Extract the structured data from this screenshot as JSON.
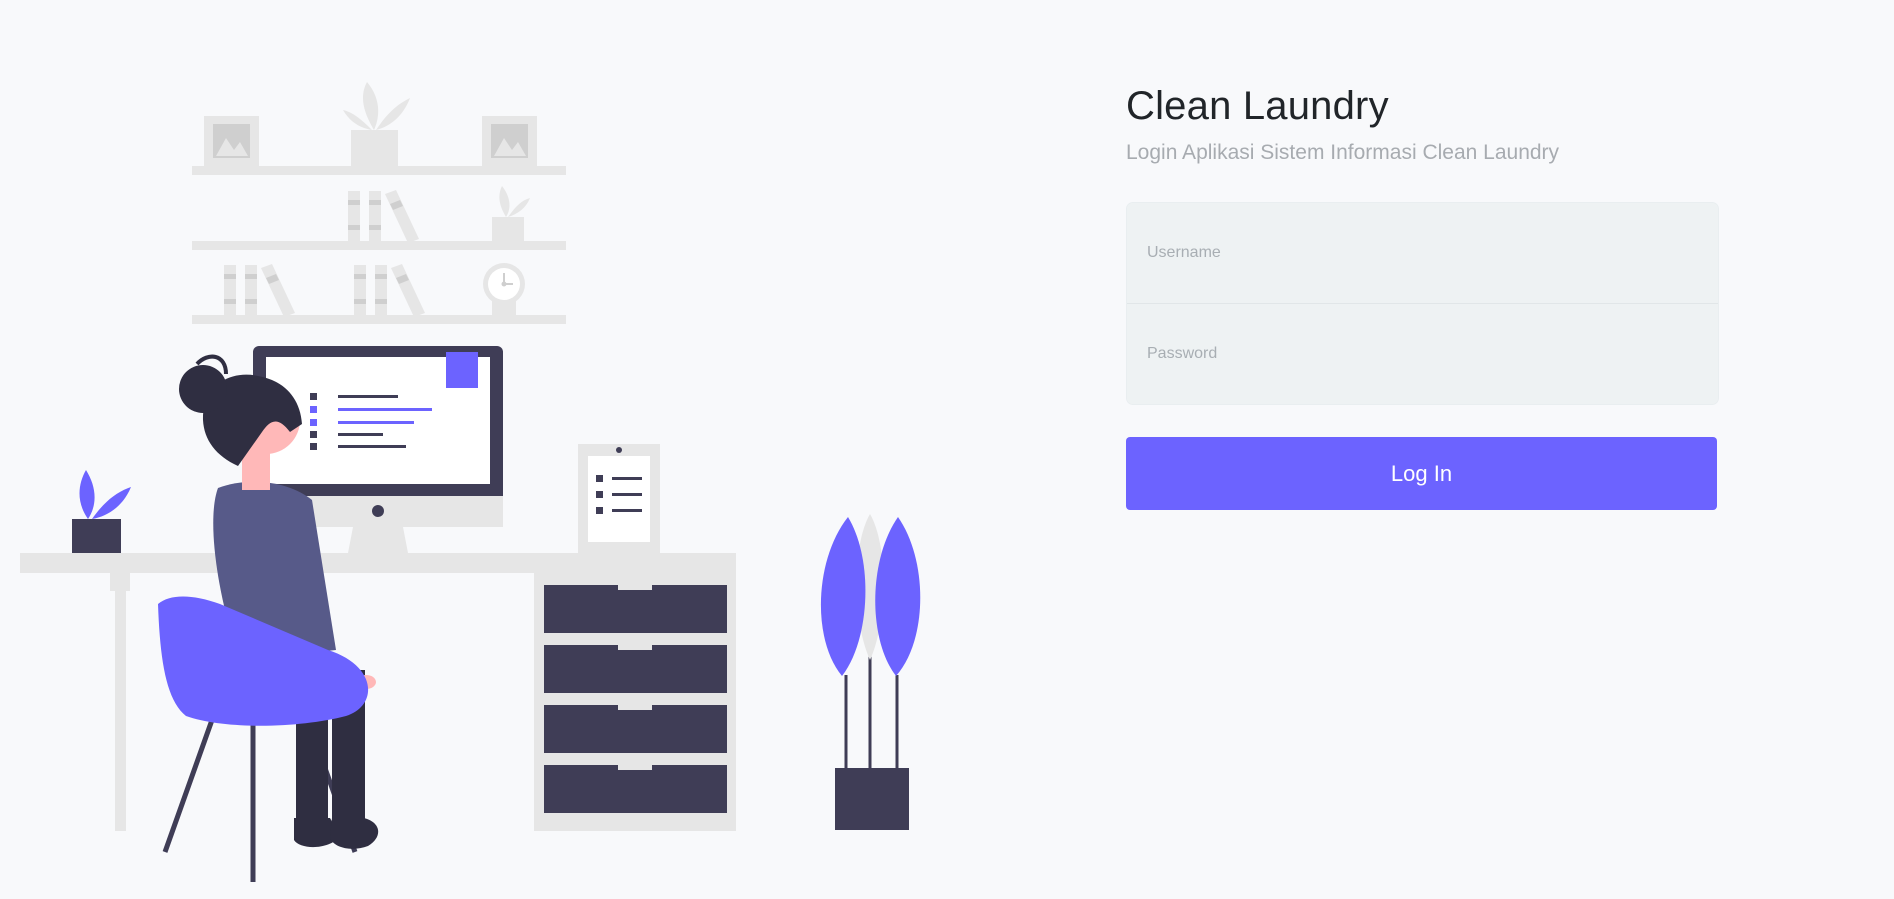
{
  "page": {
    "background": "#f8f9fb",
    "accent_color": "#6c63ff"
  },
  "illustration": {
    "subject": "person working at desk with computer, bookshelves, and plants",
    "icon_name": "office-illustration"
  },
  "login": {
    "title": "Clean Laundry",
    "subtitle": "Login Aplikasi Sistem Informasi Clean Laundry",
    "username_placeholder": "Username",
    "password_placeholder": "Password",
    "submit_label": "Log In"
  }
}
